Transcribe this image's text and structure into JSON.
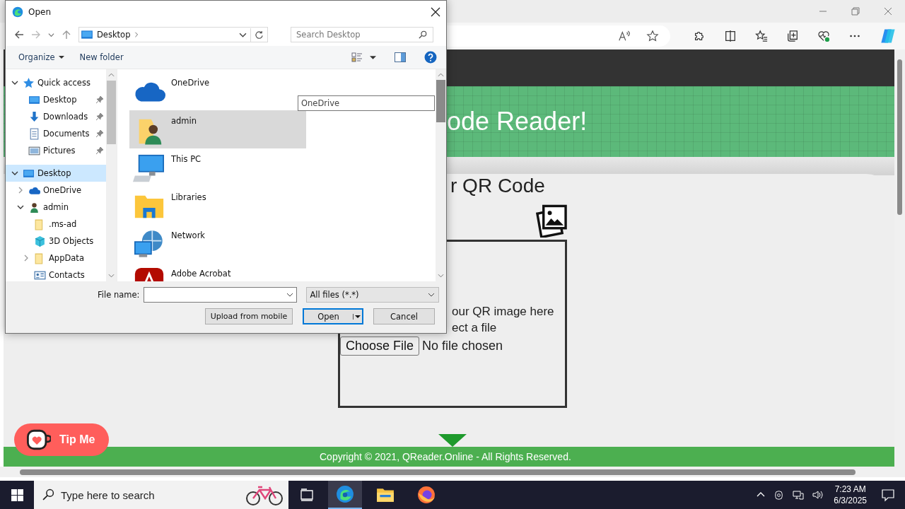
{
  "browser": {
    "page": {
      "title": "ode Reader!",
      "heading": "r QR Code",
      "drop_lines": [
        "our QR image here",
        "ect a file"
      ],
      "file_button": "Choose File",
      "file_status": "No file chosen",
      "tip_button": "Tip Me",
      "footer": "Copyright © 2021, QReader.Online - All Rights Reserved."
    }
  },
  "dialog": {
    "title": "Open",
    "location": "Desktop",
    "search_placeholder": "Search Desktop",
    "toolbar": [
      "Organize",
      "New folder"
    ],
    "nav": [
      {
        "label": "Quick access",
        "kind": "star",
        "expanded": true,
        "selected": false,
        "children": [
          {
            "label": "Desktop",
            "kind": "desktop",
            "pinned": true,
            "selected": false
          },
          {
            "label": "Downloads",
            "kind": "download",
            "pinned": true,
            "selected": false
          },
          {
            "label": "Documents",
            "kind": "document",
            "pinned": true,
            "selected": false
          },
          {
            "label": "Pictures",
            "kind": "picture",
            "pinned": true,
            "selected": false
          }
        ]
      },
      {
        "label": "Desktop",
        "kind": "desktop",
        "expanded": true,
        "selected": true,
        "children": [
          {
            "label": "OneDrive",
            "kind": "cloud",
            "expanded": false,
            "selected": false
          },
          {
            "label": "admin",
            "kind": "user",
            "expanded": true,
            "selected": false,
            "children": [
              {
                "label": ".ms-ad",
                "kind": "folder",
                "selected": false
              },
              {
                "label": "3D Objects",
                "kind": "cube",
                "selected": false
              },
              {
                "label": "AppData",
                "kind": "folder",
                "expanded": false,
                "selected": false
              },
              {
                "label": "Contacts",
                "kind": "contact",
                "selected": false
              }
            ]
          }
        ]
      }
    ],
    "items": [
      {
        "name": "OneDrive",
        "kind": "cloud",
        "selected": false
      },
      {
        "name": "admin",
        "kind": "userfolder",
        "selected": true
      },
      {
        "name": "This PC",
        "kind": "pc",
        "selected": false
      },
      {
        "name": "Libraries",
        "kind": "library",
        "selected": false
      },
      {
        "name": "Network",
        "kind": "network",
        "selected": false
      },
      {
        "name": "Adobe Acrobat",
        "kind": "acrobat",
        "selected": false
      }
    ],
    "name_tip": "OneDrive",
    "file_name_label": "File name:",
    "file_type": "All files (*.*)",
    "buttons": [
      "Upload from mobile",
      "Open",
      "Cancel"
    ]
  },
  "taskbar": {
    "search_placeholder": "Type here to search",
    "time": "7:23 AM",
    "date": "6/3/2025"
  }
}
